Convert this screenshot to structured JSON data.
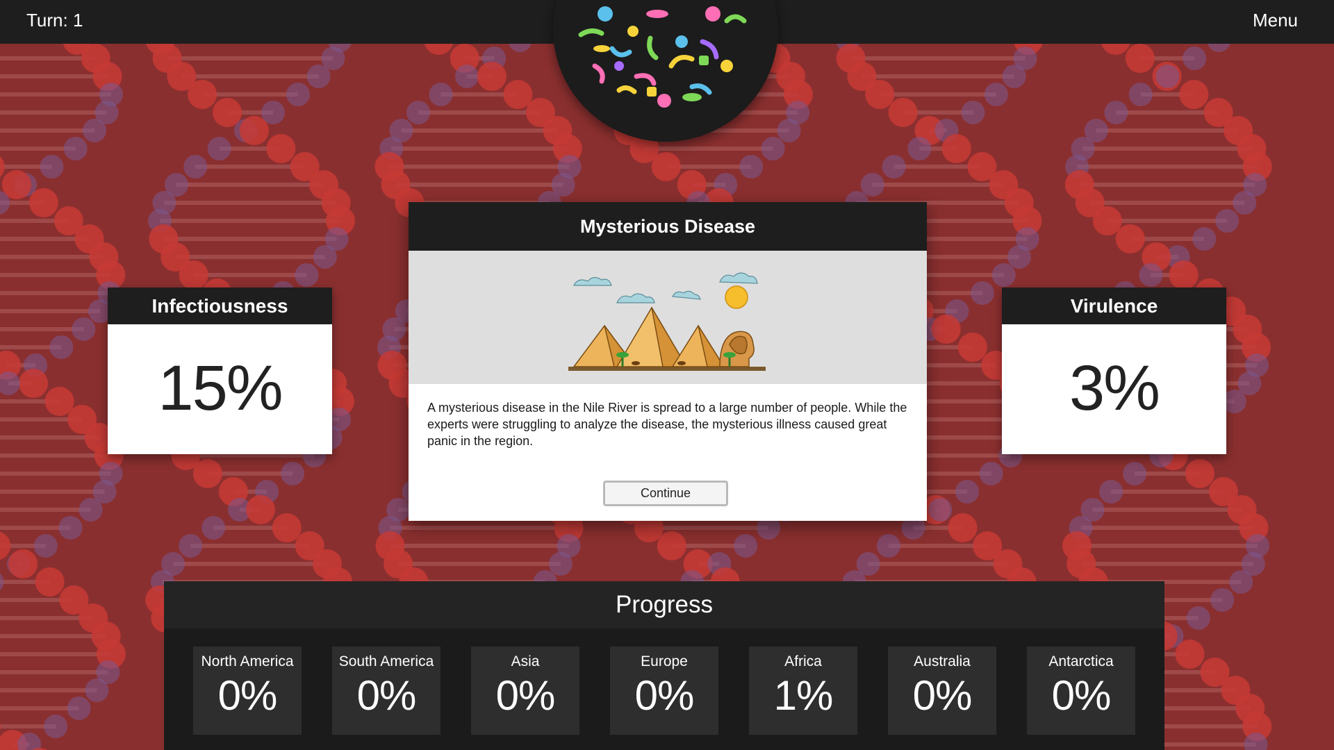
{
  "header": {
    "turn_label": "Turn: 1",
    "menu_label": "Menu"
  },
  "stats": {
    "infectiousness": {
      "title": "Infectiousness",
      "value": "15%"
    },
    "virulence": {
      "title": "Virulence",
      "value": "3%"
    }
  },
  "event": {
    "title": "Mysterious Disease",
    "description": "A mysterious disease in the Nile River is spread to a large number of people. While the experts were struggling to analyze the disease, the mysterious illness caused great panic in the region.",
    "button_label": "Continue"
  },
  "progress": {
    "title": "Progress",
    "regions": [
      {
        "name": "North America",
        "value": "0%"
      },
      {
        "name": "South America",
        "value": "0%"
      },
      {
        "name": "Asia",
        "value": "0%"
      },
      {
        "name": "Europe",
        "value": "0%"
      },
      {
        "name": "Africa",
        "value": "1%"
      },
      {
        "name": "Australia",
        "value": "0%"
      },
      {
        "name": "Antarctica",
        "value": "0%"
      }
    ]
  },
  "colors": {
    "background": "#8a2f2f",
    "bar": "#1e1e1e",
    "dna_red": "#c73a35",
    "dna_purple": "#7a5a8f"
  },
  "icons": {
    "petri_dish": "germs-petri-dish-icon",
    "event_art": "pyramids-sphinx-illustration"
  }
}
